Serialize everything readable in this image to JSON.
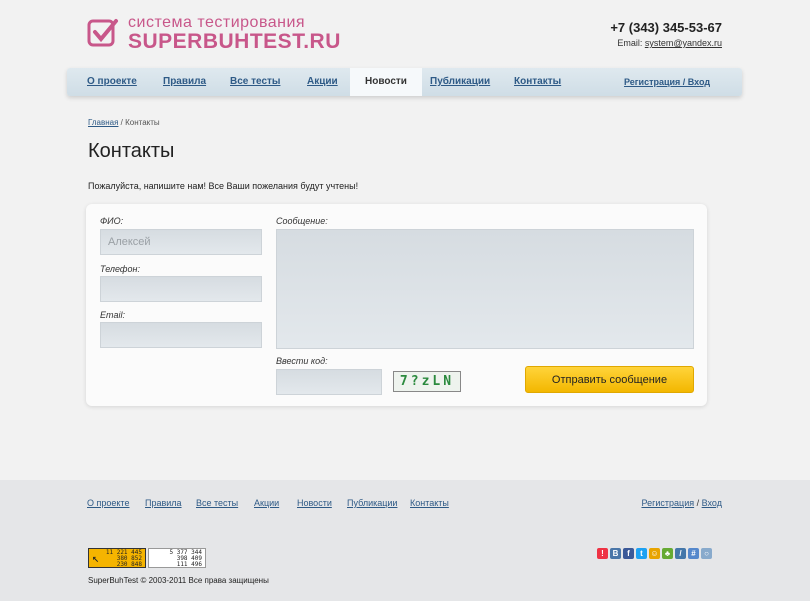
{
  "header": {
    "logo_line1": "система тестирования",
    "logo_line2": "SUPERBUHTEST.RU",
    "phone": "+7 (343) 345-53-67",
    "email_label": "Email: ",
    "email": "system@yandex.ru"
  },
  "nav": {
    "items": [
      "О проекте",
      "Правила",
      "Все тесты",
      "Акции",
      "Новости",
      "Публикации",
      "Контакты"
    ],
    "active": "Новости",
    "register": "Регистрация / Вход"
  },
  "breadcrumb": {
    "home": "Главная",
    "separator": " / ",
    "current": "Контакты"
  },
  "page": {
    "title": "Контакты",
    "intro": "Пожалуйста, напишите нам! Все Ваши пожелания будут учтены!"
  },
  "form": {
    "name_label": "ФИО:",
    "name_placeholder": "Алексей",
    "phone_label": "Телефон:",
    "email_label": "Email:",
    "message_label": "Сообщение:",
    "code_label": "Ввести код:",
    "captcha_text": "7?zLN",
    "submit_label": "Отправить сообщение"
  },
  "footer": {
    "nav": [
      "О проекте",
      "Правила",
      "Все тесты",
      "Акции",
      "Новости",
      "Публикации",
      "Контакты"
    ],
    "register": "Регистрация",
    "register_separator": " / ",
    "login": "Вход",
    "counter1": [
      "11 221 445",
      "380 852",
      "230 848"
    ],
    "counter2": [
      "5 377 344",
      "398 409",
      "111 496"
    ],
    "copyright": "SuperBuhTest © 2003-2011  Все права защищены"
  },
  "colors": {
    "accent": "#c8578a",
    "link": "#2e5a86",
    "button": "#f3b700"
  }
}
